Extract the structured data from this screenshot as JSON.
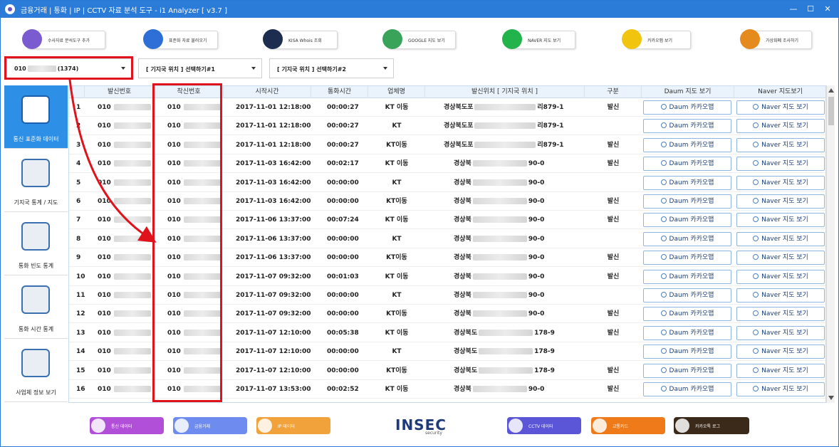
{
  "titlebar": {
    "title": "금융거래 | 통화 | IP | CCTV 자료 분석 도구 - i1 Analyzer [ v3.7 ]",
    "minimize": "—",
    "maximize": "☐",
    "close": "✕"
  },
  "toolbar": [
    {
      "label": "수사자료 분석도구 추가",
      "icon": "i1-logo-icon",
      "color": "#7b5bd0"
    },
    {
      "label": "표준화 자료 불러오기",
      "icon": "document-import-icon",
      "color": "#2d6fd6"
    },
    {
      "label": "KISA Whois 조회",
      "icon": "kisa-icon",
      "color": "#1c2d4f"
    },
    {
      "label": "GOOGLE 지도 보기",
      "icon": "google-maps-icon",
      "color": "#3aa35a"
    },
    {
      "label": "NAVER 지도 보기",
      "icon": "naver-map-icon",
      "color": "#23b34b"
    },
    {
      "label": "카카오맵 보기",
      "icon": "kakaomap-icon",
      "color": "#f1c40f"
    },
    {
      "label": "가상화폐 조사하기",
      "icon": "crypto-icon",
      "color": "#e58a1f"
    }
  ],
  "dropdowns": {
    "number_prefix": "010",
    "number_count": "(1374)",
    "location1": "[ 기지국 위치 ] 선택하기#1",
    "location2": "[ 기지국 위치 ] 선택하기#2"
  },
  "sidebar": [
    {
      "label": "통신 표준화 데이터",
      "icon": "xls-database-icon",
      "active": true
    },
    {
      "label": "기지국 통계 / 지도",
      "icon": "cell-tower-icon",
      "active": false
    },
    {
      "label": "통화 빈도 통계",
      "icon": "chart-trend-icon",
      "active": false
    },
    {
      "label": "통화 시간 통계",
      "icon": "clock-phone-icon",
      "active": false
    },
    {
      "label": "사업체 정보 보기",
      "icon": "buildings-icon",
      "active": false
    }
  ],
  "table": {
    "headers": [
      "발신번호",
      "착신번호",
      "시작시간",
      "통화시간",
      "업체명",
      "발신위치 [ 기지국 위치 ]",
      "구분",
      "Daum 지도 보기",
      "Naver 지도보기"
    ],
    "daum_btn": "Daum 카카오맵",
    "naver_btn": "Naver 지도 보기",
    "rows": [
      {
        "no": "1",
        "caller": "010",
        "callee": "010",
        "start": "2017-11-01 12:18:00",
        "dur": "00:00:27",
        "carrier": "KT 이동",
        "loc_a": "경상북도포",
        "loc_b": "리879-1",
        "type": "발신"
      },
      {
        "no": "2",
        "caller": "010",
        "callee": "010",
        "start": "2017-11-01 12:18:00",
        "dur": "00:00:27",
        "carrier": "KT",
        "loc_a": "경상북도포",
        "loc_b": "리879-1",
        "type": ""
      },
      {
        "no": "3",
        "caller": "010",
        "callee": "010",
        "start": "2017-11-01 12:18:00",
        "dur": "00:00:27",
        "carrier": "KT이동",
        "loc_a": "경상북도포",
        "loc_b": "리879-1",
        "type": "발신"
      },
      {
        "no": "4",
        "caller": "010",
        "callee": "010",
        "start": "2017-11-03 16:42:00",
        "dur": "00:02:17",
        "carrier": "KT 이동",
        "loc_a": "경상북",
        "loc_b": "90-0",
        "type": "발신"
      },
      {
        "no": "5",
        "caller": "010",
        "callee": "010",
        "start": "2017-11-03 16:42:00",
        "dur": "00:00:00",
        "carrier": "KT",
        "loc_a": "경상북",
        "loc_b": "90-0",
        "type": ""
      },
      {
        "no": "6",
        "caller": "010",
        "callee": "010",
        "start": "2017-11-03 16:42:00",
        "dur": "00:00:00",
        "carrier": "KT이동",
        "loc_a": "경상북",
        "loc_b": "90-0",
        "type": "발신"
      },
      {
        "no": "7",
        "caller": "010",
        "callee": "010",
        "start": "2017-11-06 13:37:00",
        "dur": "00:07:24",
        "carrier": "KT 이동",
        "loc_a": "경상북",
        "loc_b": "90-0",
        "type": "발신"
      },
      {
        "no": "8",
        "caller": "010",
        "callee": "010",
        "start": "2017-11-06 13:37:00",
        "dur": "00:00:00",
        "carrier": "KT",
        "loc_a": "경상북",
        "loc_b": "90-0",
        "type": ""
      },
      {
        "no": "9",
        "caller": "010",
        "callee": "010",
        "start": "2017-11-06 13:37:00",
        "dur": "00:00:00",
        "carrier": "KT이동",
        "loc_a": "경상북",
        "loc_b": "90-0",
        "type": "발신"
      },
      {
        "no": "10",
        "caller": "010",
        "callee": "010",
        "start": "2017-11-07 09:32:00",
        "dur": "00:01:03",
        "carrier": "KT 이동",
        "loc_a": "경상북",
        "loc_b": "90-0",
        "type": "발신"
      },
      {
        "no": "11",
        "caller": "010",
        "callee": "010",
        "start": "2017-11-07 09:32:00",
        "dur": "00:00:00",
        "carrier": "KT",
        "loc_a": "경상북",
        "loc_b": "90-0",
        "type": ""
      },
      {
        "no": "12",
        "caller": "010",
        "callee": "010",
        "start": "2017-11-07 09:32:00",
        "dur": "00:00:00",
        "carrier": "KT이동",
        "loc_a": "경상북",
        "loc_b": "90-0",
        "type": "발신"
      },
      {
        "no": "13",
        "caller": "010",
        "callee": "010",
        "start": "2017-11-07 12:10:00",
        "dur": "00:05:38",
        "carrier": "KT 이동",
        "loc_a": "경상북도",
        "loc_b": "178-9",
        "type": "발신"
      },
      {
        "no": "14",
        "caller": "010",
        "callee": "010",
        "start": "2017-11-07 12:10:00",
        "dur": "00:00:00",
        "carrier": "KT",
        "loc_a": "경상북도",
        "loc_b": "178-9",
        "type": ""
      },
      {
        "no": "15",
        "caller": "010",
        "callee": "010",
        "start": "2017-11-07 12:10:00",
        "dur": "00:00:00",
        "carrier": "KT이동",
        "loc_a": "경상북도",
        "loc_b": "178-9",
        "type": "발신"
      },
      {
        "no": "16",
        "caller": "010",
        "callee": "010",
        "start": "2017-11-07 13:53:00",
        "dur": "00:02:52",
        "carrier": "KT 이동",
        "loc_a": "경상북",
        "loc_b": "90-0",
        "type": "발신"
      }
    ]
  },
  "bottom_bar": [
    {
      "label": "통신 데이터",
      "icon": "phone-data-icon",
      "color": "#b14fd8"
    },
    {
      "label": "금융거래",
      "icon": "bank-icon",
      "color": "#6e8cf0"
    },
    {
      "label": "IP 데이터",
      "icon": "ip-map-icon",
      "color": "#f2a23a"
    },
    {
      "label": "CCTV 데이터",
      "icon": "cctv-icon",
      "color": "#5b55d8"
    },
    {
      "label": "교통카드",
      "icon": "transit-card-icon",
      "color": "#ef7a1a"
    },
    {
      "label": "카카오톡 로그",
      "icon": "kakaotalk-icon",
      "color": "#3b2a1a"
    }
  ],
  "logo": {
    "brand": "INSEC",
    "sub": "security"
  }
}
